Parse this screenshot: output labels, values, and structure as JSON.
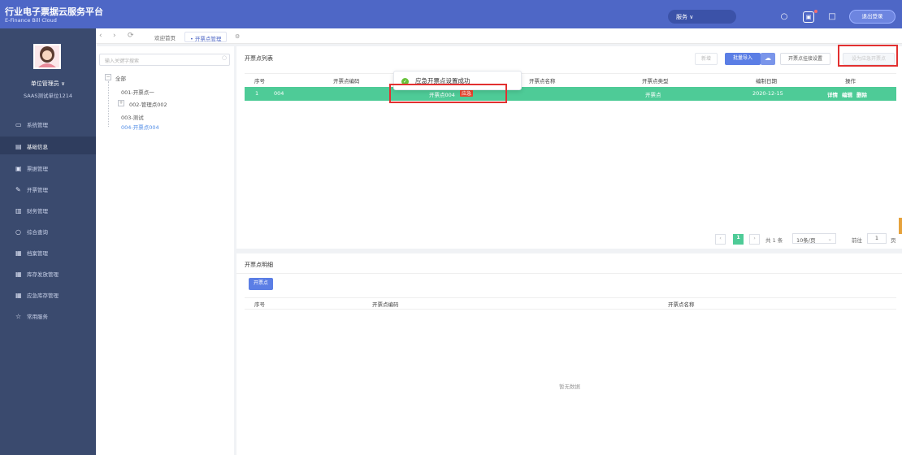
{
  "header": {
    "brand_title": "行业电子票据云服务平台",
    "brand_subtitle": "E-Finance Bill Cloud",
    "service_dropdown": "服务 ∨",
    "logout_label": "退出登录"
  },
  "user": {
    "name": "单位管理员 ∨",
    "org": "SAAS测试单位1214"
  },
  "sidebar": {
    "items": [
      {
        "label": "系统管理",
        "icon": "▭"
      },
      {
        "label": "基础信息",
        "icon": "▤"
      },
      {
        "label": "票据管理",
        "icon": "▣"
      },
      {
        "label": "开票管理",
        "icon": "✎"
      },
      {
        "label": "财务管理",
        "icon": "▥"
      },
      {
        "label": "综合查询",
        "icon": "○"
      },
      {
        "label": "档案管理",
        "icon": "▦"
      },
      {
        "label": "库存发放管理",
        "icon": "▦"
      },
      {
        "label": "应急库存管理",
        "icon": "▦"
      },
      {
        "label": "常用服务",
        "icon": "☆"
      }
    ]
  },
  "tabs": [
    {
      "label": "欢迎首页"
    },
    {
      "label": "• 开票点管理"
    }
  ],
  "tree": {
    "search_placeholder": "输入关键字搜索",
    "nodes": [
      {
        "label": "全部",
        "expander": "−"
      },
      {
        "label": "001-开票点一"
      },
      {
        "label": "002-管理点002",
        "expander": "+"
      },
      {
        "label": "003-测试"
      },
      {
        "label": "004-开票点004"
      }
    ]
  },
  "list": {
    "title": "开票点列表",
    "buttons": {
      "add": "新增",
      "batch_import": "批量导入",
      "mount_settings": "开票点挂接设置",
      "set_emergency": "设为应急开票点"
    },
    "columns": [
      "序号",
      "开票点编码",
      "开票点名称",
      "开票点类型",
      "编制日期",
      "操作"
    ],
    "rows": [
      {
        "index": "1",
        "code": "004",
        "name": "开票点004",
        "badge": "应急",
        "type": "开票点",
        "date": "2020-12-15",
        "actions": [
          "详情",
          "编辑",
          "删除"
        ]
      }
    ],
    "pagination": {
      "current_page": "1",
      "total": "共 1 条",
      "page_size": "10条/页",
      "goto_label": "前往",
      "goto_value": "1",
      "page_suffix": "页"
    }
  },
  "toast": {
    "message": "应急开票点设置成功"
  },
  "detail": {
    "title": "开票点明细",
    "tag_button": "开票点",
    "columns": [
      "序号",
      "开票点编码",
      "开票点名称"
    ],
    "empty_text": "暂无数据"
  },
  "colors": {
    "topbar": "#4e67c6",
    "sidebar": "#3a4a6e",
    "row_highlight": "#4ecb97",
    "primary_button": "#5b7ee5",
    "annotation_red": "#e23030"
  }
}
